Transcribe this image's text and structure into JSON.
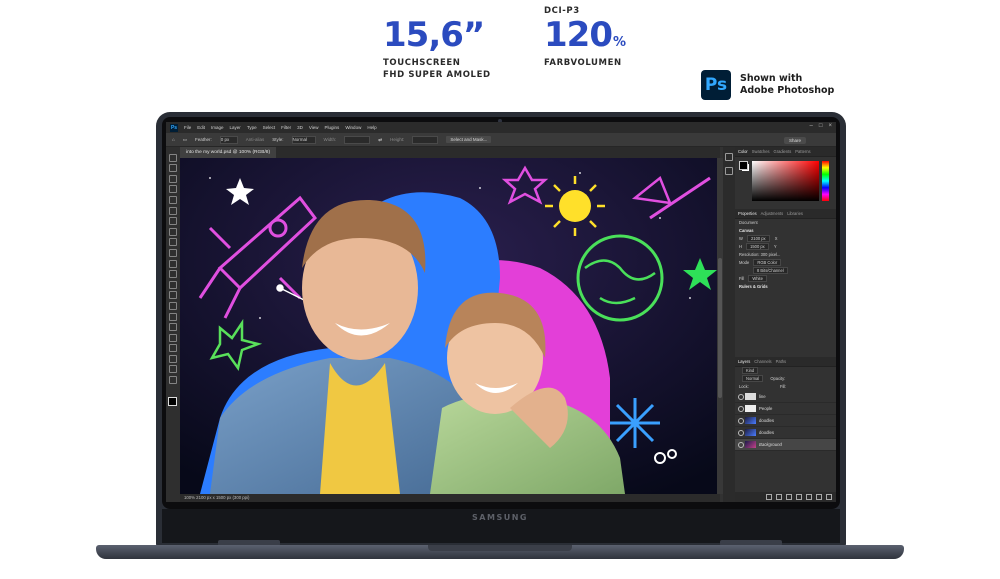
{
  "specs": {
    "display_size": "15,6”",
    "display_line1": "TOUCHSCREEN",
    "display_line2": "FHD SUPER AMOLED",
    "gamut_prefix": "DCI-P3",
    "gamut_value": "120",
    "gamut_unit": "%",
    "gamut_label": "FARBVOLUMEN"
  },
  "ps_badge": {
    "label": "Ps",
    "note_line1": "Shown with",
    "note_line2": "Adobe Photoshop"
  },
  "device": {
    "brand": "SAMSUNG"
  },
  "photoshop": {
    "menu": [
      "File",
      "Edit",
      "Image",
      "Layer",
      "Type",
      "Select",
      "Filter",
      "3D",
      "View",
      "Plugins",
      "Window",
      "Help"
    ],
    "options": {
      "feather_label": "Feather:",
      "feather_value": "0 px",
      "anti_alias": "Anti-alias",
      "style_label": "Style:",
      "style_value": "Normal",
      "width_label": "Width:",
      "height_label": "Height:",
      "select_mask": "Select and Mask...",
      "share": "Share"
    },
    "document_tab": "into the my world.psd @ 100% (RGB/8)",
    "status": "100%    2100 px x 1500 px (300 ppi)",
    "color_tabs": [
      "Color",
      "Swatches",
      "Gradients",
      "Patterns"
    ],
    "props_tabs": [
      "Properties",
      "Adjustments",
      "Libraries"
    ],
    "properties": {
      "doc_label": "Document",
      "canvas_head": "Canvas",
      "w_label": "W",
      "w_value": "2100 px",
      "x_label": "X",
      "h_label": "H",
      "h_value": "1500 px",
      "y_label": "Y",
      "resolution": "Resolution: 300 pixel...",
      "mode_label": "Mode",
      "mode_value": "RGB Color",
      "depth_value": "8 Bits/Channel",
      "fill_label": "Fill",
      "fill_value": "White",
      "rulers_head": "Rulers & Grids"
    },
    "layer_tabs": [
      "Layers",
      "Channels",
      "Paths"
    ],
    "layer_controls": {
      "kind": "Kind",
      "blend": "Normal",
      "opacity": "Opacity:",
      "lock": "Lock:",
      "fill": "Fill:"
    },
    "layers": [
      "line",
      "People",
      "doodles",
      "doodles",
      "Background"
    ]
  },
  "colors": {
    "accent_blue": "#2b4bbf",
    "ps_dark": "#001e36",
    "ps_blue": "#31a8ff"
  }
}
